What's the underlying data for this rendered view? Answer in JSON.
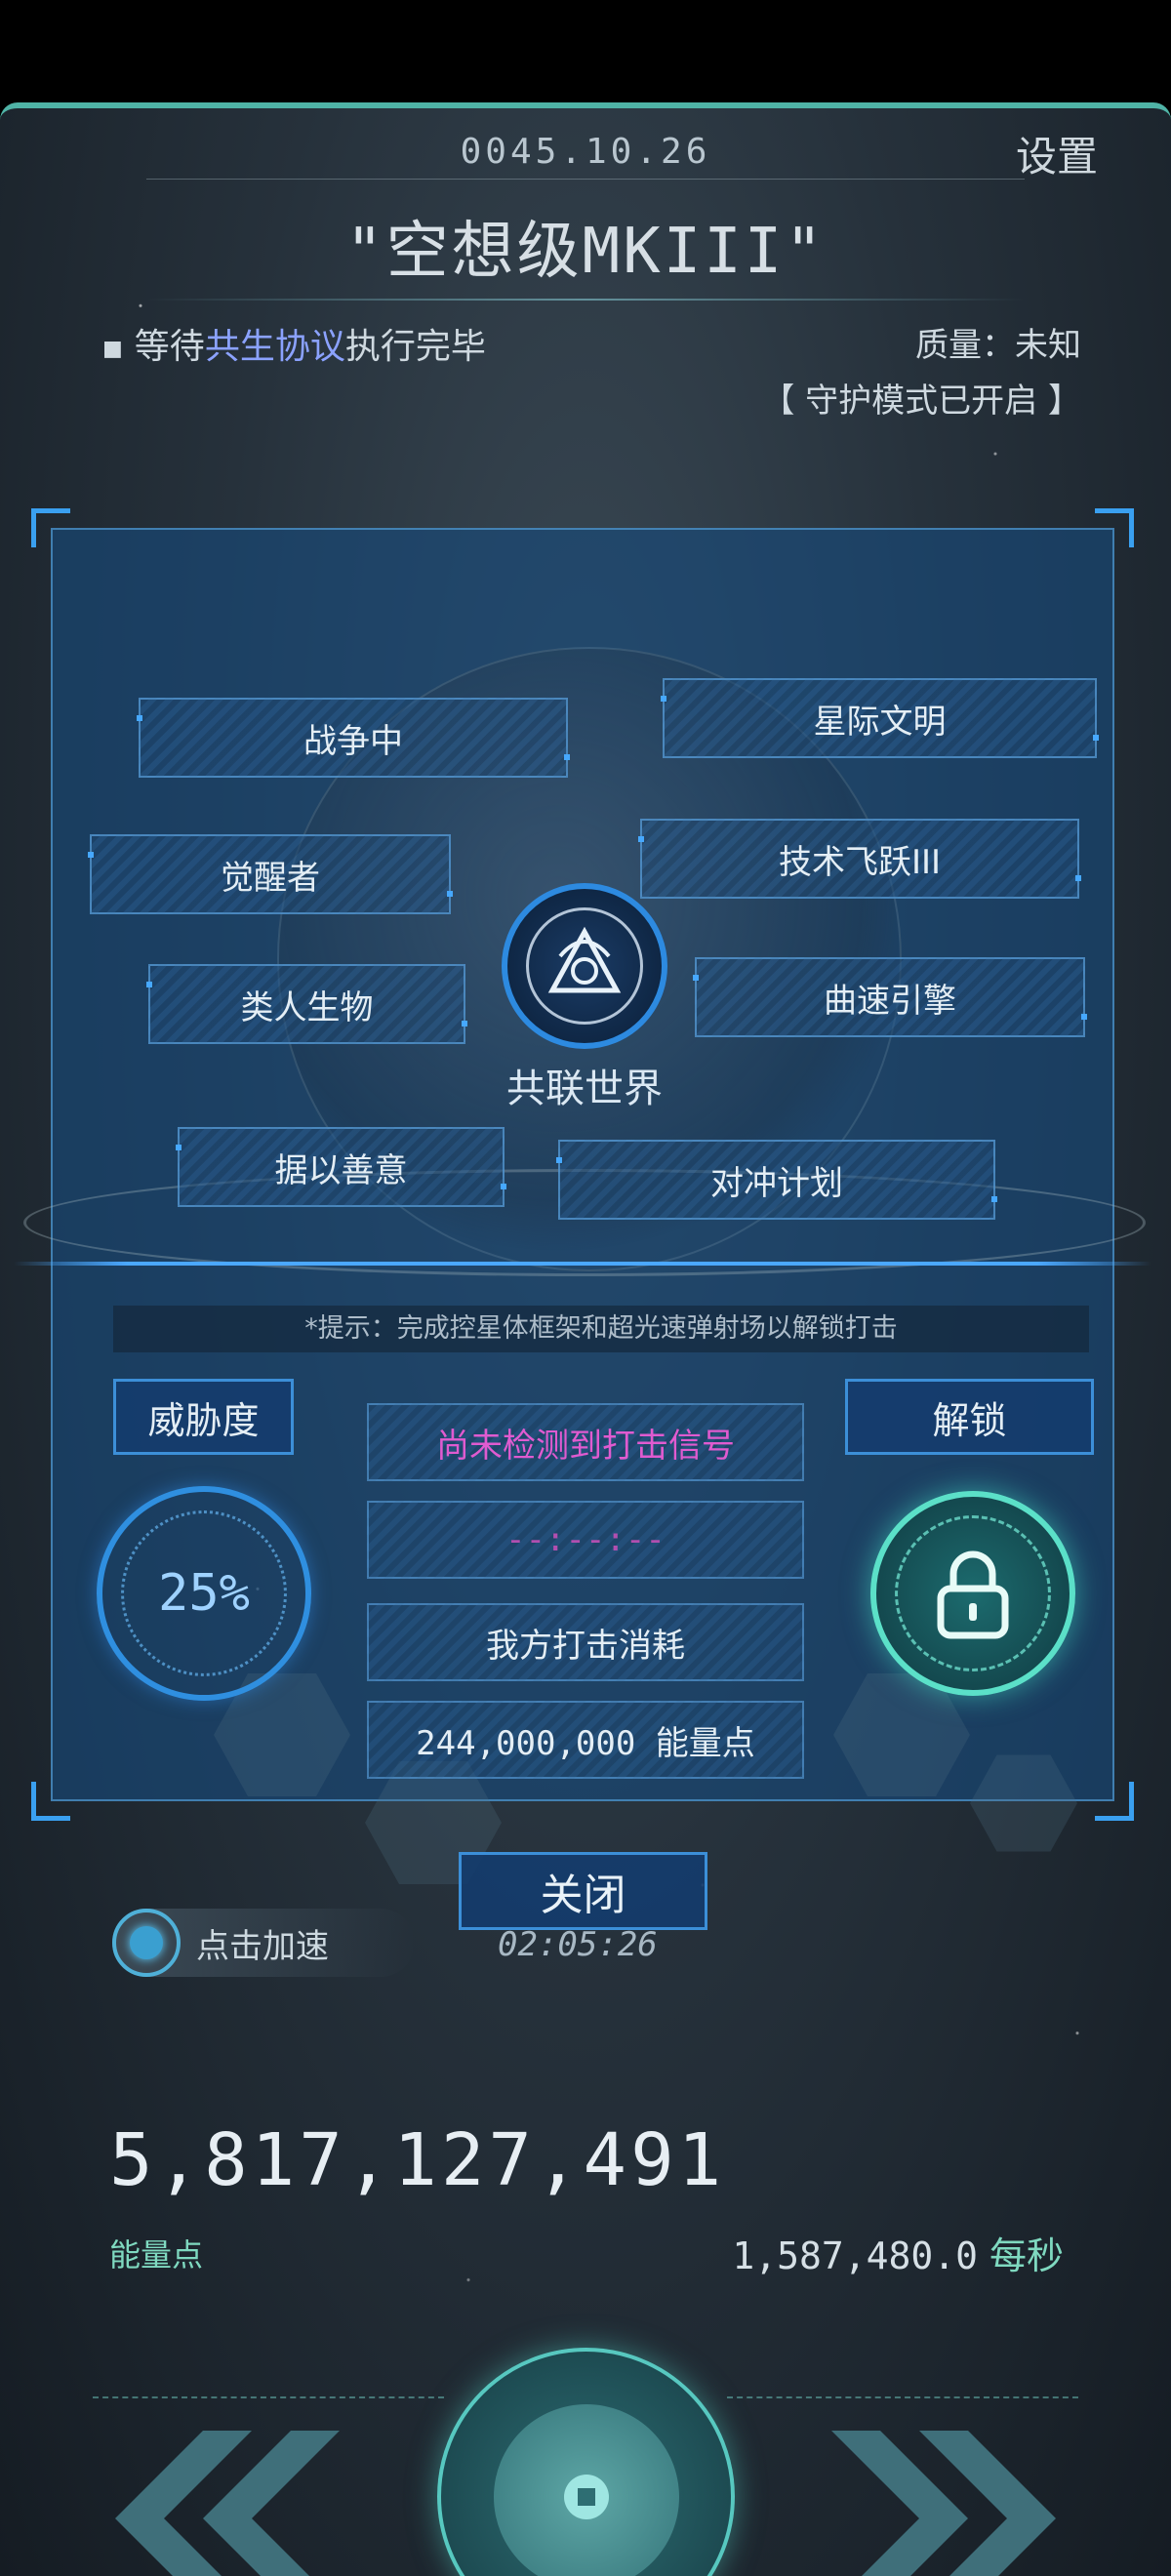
{
  "header": {
    "date": "0045.10.26",
    "settings_label": "设置",
    "ship_name": "\"空想级MKIII\""
  },
  "status": {
    "prefix": "等待",
    "highlight": "共生协议",
    "suffix": "执行完毕",
    "quality": "质量：未知",
    "guard_mode": "【 守护模式已开启 】"
  },
  "tags": [
    {
      "label": "战争中"
    },
    {
      "label": "星际文明"
    },
    {
      "label": "觉醒者"
    },
    {
      "label": "技术飞跃III"
    },
    {
      "label": "类人生物"
    },
    {
      "label": "曲速引擎"
    },
    {
      "label": "据以善意"
    },
    {
      "label": "对冲计划"
    }
  ],
  "world_name": "共联世界",
  "hint": "*提示：完成控星体框架和超光速弹射场以解锁打击",
  "threat": {
    "label": "威胁度",
    "value": "25%",
    "level": 0.25
  },
  "strike": {
    "signal": "尚未检测到打击信号",
    "timer": "--:--:--",
    "cost_label": "我方打击消耗",
    "cost_value": "244,000,000 能量点"
  },
  "unlock_label": "解锁",
  "close_label": "关闭",
  "speedup_label": "点击加速",
  "countdown": "02:05:26",
  "energy": {
    "total": "5,817,127,491",
    "label": "能量点",
    "rate": "1,587,480.0",
    "rate_unit": "每秒"
  },
  "icons": [
    "gear-icon",
    "emblem-icon",
    "lock-icon",
    "speedup-icon",
    "chevron-left-icon",
    "chevron-right-icon",
    "core-button-icon"
  ],
  "colors": {
    "accent_blue": "#3c8fd8",
    "accent_teal": "#5be0c8",
    "signal_magenta": "#e05bd0",
    "highlight_purple": "#8ba2ff"
  }
}
